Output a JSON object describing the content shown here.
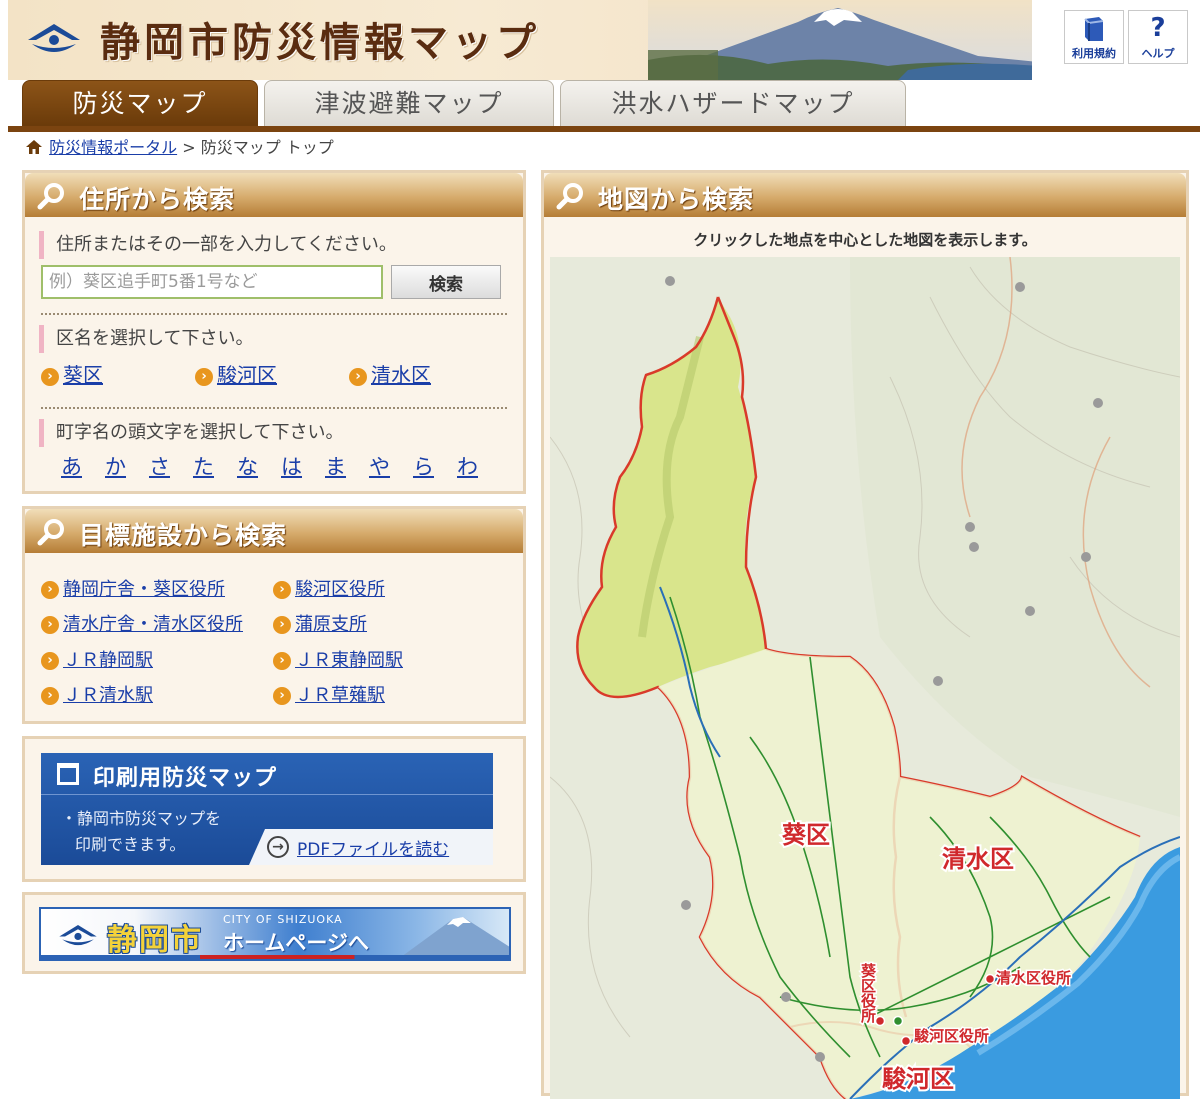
{
  "header": {
    "site_title": "静岡市防災情報マップ",
    "terms_label": "利用規約",
    "help_label": "ヘルプ",
    "help_glyph": "?"
  },
  "tabs": [
    {
      "label": "防災マップ",
      "active": true
    },
    {
      "label": "津波避難マップ",
      "active": false
    },
    {
      "label": "洪水ハザードマップ",
      "active": false
    }
  ],
  "breadcrumb": {
    "portal_link": "防災情報ポータル",
    "separator": ">",
    "current": "防災マップ トップ"
  },
  "address_search": {
    "title": "住所から検索",
    "instruction": "住所またはその一部を入力してください。",
    "placeholder": "例）葵区追手町5番1号など",
    "button": "検索",
    "ward_instruction": "区名を選択して下さい。",
    "wards": [
      "葵区",
      "駿河区",
      "清水区"
    ],
    "kana_instruction": "町字名の頭文字を選択して下さい。",
    "kana": [
      "あ",
      "か",
      "さ",
      "た",
      "な",
      "は",
      "ま",
      "や",
      "ら",
      "わ"
    ]
  },
  "facility_search": {
    "title": "目標施設から検索",
    "items": [
      "静岡庁舎・葵区役所",
      "駿河区役所",
      "清水庁舎・清水区役所",
      "蒲原支所",
      "ＪＲ静岡駅",
      "ＪＲ東静岡駅",
      "ＪＲ清水駅",
      "ＪＲ草薙駅"
    ]
  },
  "print_map": {
    "title": "印刷用防災マップ",
    "desc_line1": "・静岡市防災マップを",
    "desc_line2": "印刷できます。",
    "pdf_link": "PDFファイルを読む"
  },
  "city_banner": {
    "name": "静岡市",
    "name_en": "CITY OF SHIZUOKA",
    "homepage": "ホームページへ"
  },
  "map_search": {
    "title": "地図から検索",
    "caption": "クリックした地点を中心とした地図を表示します。",
    "labels": {
      "aoi": "葵区",
      "shimizu": "清水区",
      "suruga": "駿河区",
      "aoi_office": "葵区役所",
      "suruga_office": "駿河区役所",
      "shimizu_office": "清水区役所"
    }
  },
  "colors": {
    "brand_brown": "#6b3b0a",
    "link_blue": "#1a3ea8",
    "boundary_red": "#d93a2a",
    "aoi_fill": "#dfe89a",
    "sea_blue": "#3a9be0"
  }
}
